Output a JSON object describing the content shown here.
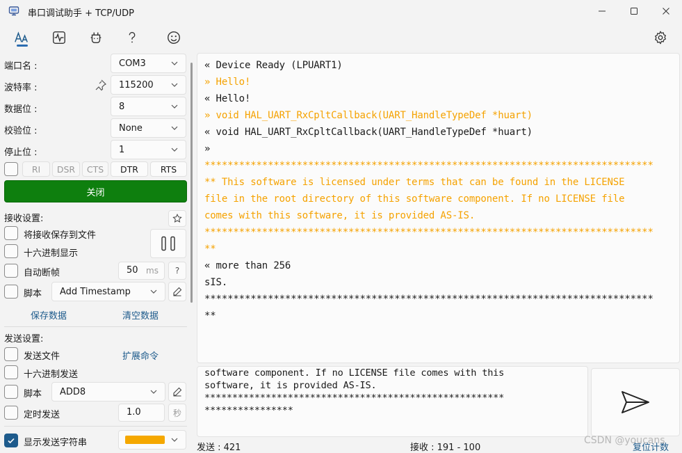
{
  "window": {
    "title": "串口调试助手 + TCP/UDP",
    "controls": [
      "minimize-icon",
      "maximize-icon",
      "close-icon"
    ]
  },
  "toolbar": {
    "items": [
      "text-icon",
      "pulse-icon",
      "plugin-icon",
      "help-icon",
      "smile-icon"
    ],
    "settings_icon": "gear-icon"
  },
  "serial": {
    "port_label": "端口名 :",
    "port_value": "COM3",
    "baud_label": "波特率 :",
    "baud_value": "115200",
    "databits_label": "数据位 :",
    "databits_value": "8",
    "parity_label": "校验位 :",
    "parity_value": "None",
    "stopbits_label": "停止位 :",
    "stopbits_value": "1",
    "signals": [
      {
        "label": "RI",
        "active": false
      },
      {
        "label": "DSR",
        "active": false
      },
      {
        "label": "CTS",
        "active": false
      },
      {
        "label": "DTR",
        "active": true
      },
      {
        "label": "RTS",
        "active": true
      }
    ],
    "close_button": "关闭",
    "close_color": "#0e7f0e"
  },
  "receive_settings": {
    "title": "接收设置:",
    "save_to_file": "将接收保存到文件",
    "hex_display": "十六进制显示",
    "auto_frame": "自动断帧",
    "frame_ms_value": "50",
    "frame_ms_unit": "ms",
    "frame_help": "?",
    "script_label": "脚本",
    "script_value": "Add Timestamp",
    "save_data": "保存数据",
    "clear_data": "清空数据"
  },
  "send_settings": {
    "title": "发送设置:",
    "send_file": "发送文件",
    "extend_cmd": "扩展命令",
    "hex_send": "十六进制发送",
    "script_label": "脚本",
    "script_value": "ADD8",
    "timed_send": "定时发送",
    "timed_value": "1.0",
    "timed_unit": "秒",
    "show_send_string": "显示发送字符串",
    "send_string_color": "#f5a800"
  },
  "receive_log": {
    "lines": [
      {
        "text": "« Device Ready (LPUART1)",
        "color": "normal"
      },
      {
        "text": "» Hello!",
        "color": "orange"
      },
      {
        "text": "« Hello!",
        "color": "normal"
      },
      {
        "text": "» void HAL_UART_RxCpltCallback(UART_HandleTypeDef *huart)",
        "color": "orange"
      },
      {
        "text": "« void HAL_UART_RxCpltCallback(UART_HandleTypeDef *huart)",
        "color": "normal"
      },
      {
        "text": "»",
        "color": "normal"
      },
      {
        "text": "******************************************************************************",
        "color": "orange"
      },
      {
        "text": "** This software is licensed under terms that can be found in the LICENSE",
        "color": "orange"
      },
      {
        "text": "file in the root directory of this software component. If no LICENSE file",
        "color": "orange"
      },
      {
        "text": "comes with this software, it is provided AS-IS.",
        "color": "orange"
      },
      {
        "text": "******************************************************************************",
        "color": "orange"
      },
      {
        "text": "**",
        "color": "orange"
      },
      {
        "text": "« more than 256",
        "color": "normal"
      },
      {
        "text": "sIS.",
        "color": "normal"
      },
      {
        "text": "******************************************************************************",
        "color": "normal"
      },
      {
        "text": "**",
        "color": "normal"
      }
    ]
  },
  "send_box": {
    "lines": [
      "software component. If no LICENSE file comes with this",
      "software, it is provided AS-IS.",
      "******************************************************",
      "****************"
    ]
  },
  "status": {
    "sent": "发送 : 421",
    "received": "接收 : 191 - 100",
    "reset_count": "复位计数",
    "watermark": "CSDN @youcans"
  },
  "colors": {
    "accent": "#1e5b8c",
    "orange": "#f5a200",
    "green": "#0e7f0e"
  }
}
